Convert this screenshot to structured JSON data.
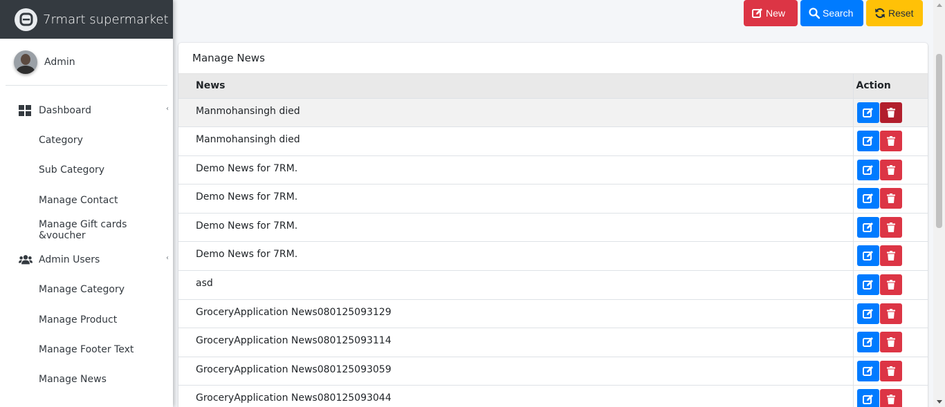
{
  "brand": {
    "name": "7rmart supermarket"
  },
  "user": {
    "name": "Admin"
  },
  "sidebar": {
    "items": [
      {
        "label": "Dashboard",
        "type": "parent",
        "icon": "dashboard-icon"
      },
      {
        "label": "Category",
        "type": "child"
      },
      {
        "label": "Sub Category",
        "type": "child"
      },
      {
        "label": "Manage Contact",
        "type": "child"
      },
      {
        "label": "Manage Gift cards &voucher",
        "type": "child"
      },
      {
        "label": "Admin Users",
        "type": "parent",
        "icon": "users-icon"
      },
      {
        "label": "Manage Category",
        "type": "child"
      },
      {
        "label": "Manage Product",
        "type": "child"
      },
      {
        "label": "Manage Footer Text",
        "type": "child"
      },
      {
        "label": "Manage News",
        "type": "child"
      }
    ]
  },
  "toolbar": {
    "new_label": "New",
    "search_label": "Search",
    "reset_label": "Reset"
  },
  "card": {
    "title": "Manage News"
  },
  "table": {
    "columns": [
      "News",
      "Action"
    ],
    "rows": [
      "Manmohansingh died",
      "Manmohansingh died",
      "Demo News for 7RM.",
      "Demo News for 7RM.",
      "Demo News for 7RM.",
      "Demo News for 7RM.",
      "asd",
      "GroceryApplication News080125093129",
      "GroceryApplication News080125093114",
      "GroceryApplication News080125093059",
      "GroceryApplication News080125093044"
    ]
  },
  "colors": {
    "danger": "#dc3545",
    "primary": "#007bff",
    "warning": "#ffc107",
    "brand_bg": "#343a40"
  }
}
